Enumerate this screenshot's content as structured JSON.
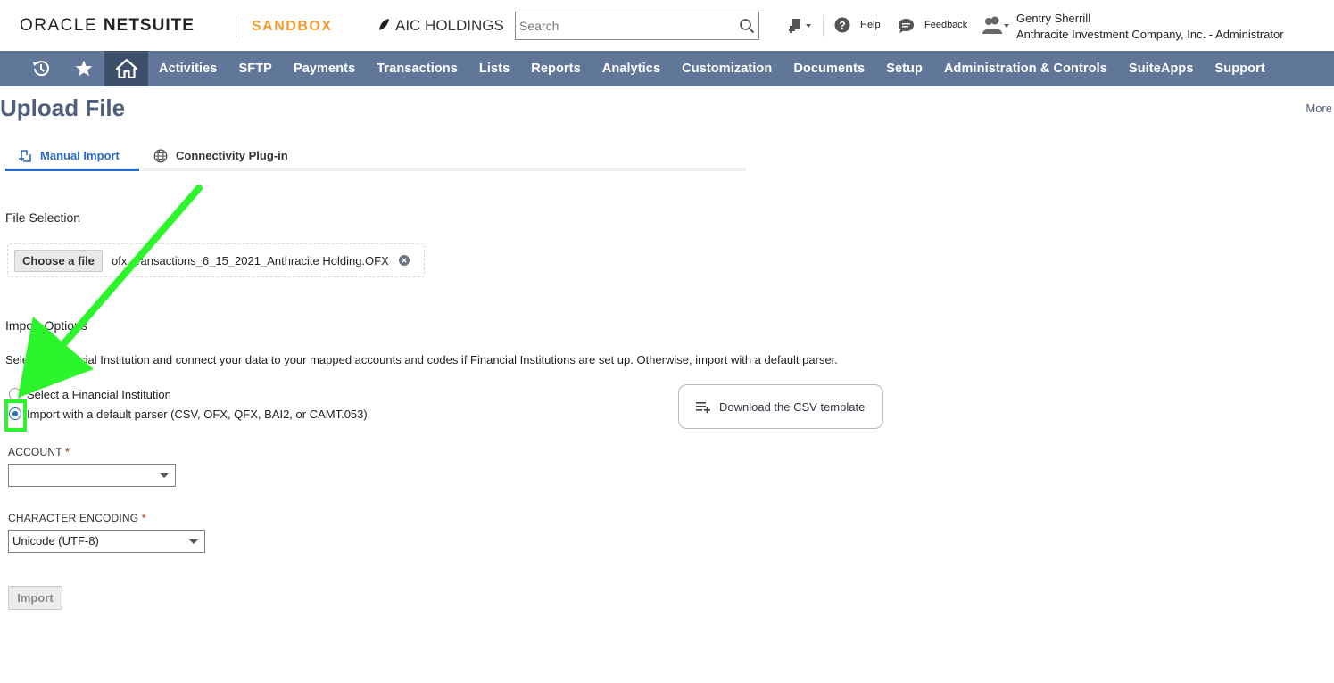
{
  "header": {
    "brand_prefix": "ORACLE ",
    "brand_suffix": "NETSUITE",
    "environment": "SANDBOX",
    "company": "AIC HOLDINGS",
    "search_placeholder": "Search",
    "help_label": "Help",
    "feedback_label": "Feedback",
    "user_name": "Gentry Sherrill",
    "user_role": "Anthracite Investment Company, Inc. - Administrator",
    "icons": [
      "create-new-icon",
      "help-icon",
      "feedback-icon",
      "user-roles-icon"
    ]
  },
  "nav": {
    "icons": [
      "recent-records-icon",
      "shortcuts-star-icon",
      "home-icon"
    ],
    "items": [
      "Activities",
      "SFTP",
      "Payments",
      "Transactions",
      "Lists",
      "Reports",
      "Analytics",
      "Customization",
      "Documents",
      "Setup",
      "Administration & Controls",
      "SuiteApps",
      "Support"
    ]
  },
  "page": {
    "title": "Upload File",
    "more": "More"
  },
  "tabs": {
    "manual": "Manual Import",
    "plugin": "Connectivity Plug-in",
    "active": "manual"
  },
  "file_selection": {
    "heading": "File Selection",
    "choose_label": "Choose a file",
    "file_name": "ofx_transactions_6_15_2021_Anthracite Holding.OFX"
  },
  "import_options": {
    "heading": "Import Options",
    "description": "Select a Financial Institution and connect your data to your mapped accounts and codes if Financial Institutions are set up. Otherwise, import with a default parser.",
    "option_institution": "Select a Financial Institution",
    "option_default_parser": "Import with a default parser (CSV, OFX, QFX, BAI2, or CAMT.053)",
    "selected": "default_parser",
    "csv_template_label": "Download the CSV template"
  },
  "form": {
    "account_label": "ACCOUNT",
    "account_value": "",
    "encoding_label": "CHARACTER ENCODING",
    "encoding_value": "Unicode (UTF-8)",
    "required_marker": "*",
    "import_button": "Import"
  },
  "annotation": {
    "color": "#2cf52c"
  },
  "colors": {
    "nav_bg": "#607799",
    "nav_home_bg": "#3d4f6b",
    "title": "#4d5f7b",
    "accent_blue": "#2a6bc6",
    "sandbox_orange": "#f29b2f"
  }
}
